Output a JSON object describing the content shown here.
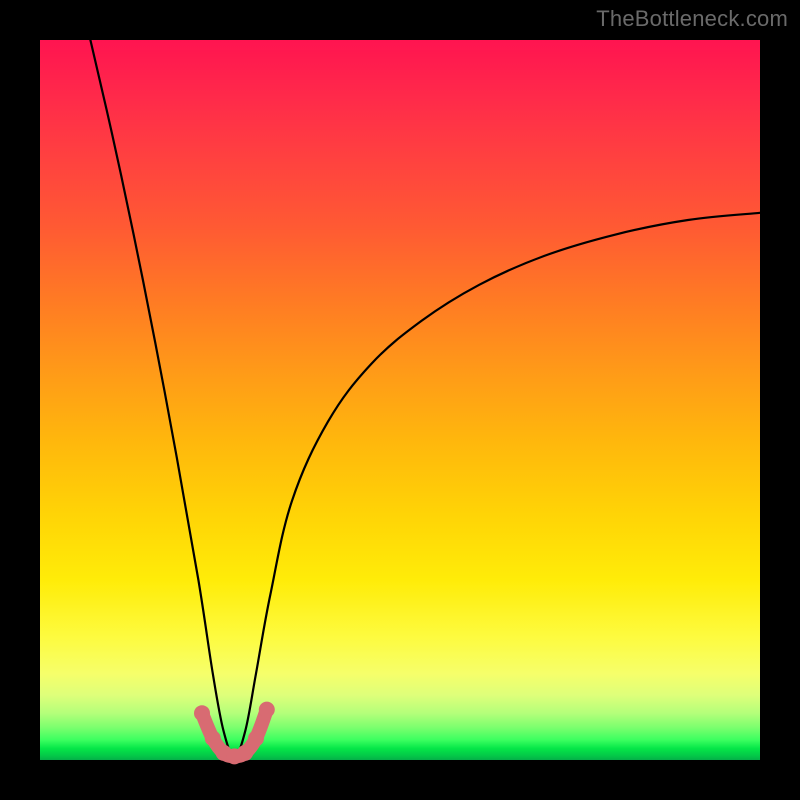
{
  "watermark": "TheBottleneck.com",
  "colors": {
    "frame": "#000000",
    "curve": "#000000",
    "accent": "#d86b72"
  },
  "chart_data": {
    "type": "line",
    "title": "",
    "xlabel": "",
    "ylabel": "",
    "xlim": [
      0,
      100
    ],
    "ylim": [
      0,
      100
    ],
    "grid": false,
    "legend": false,
    "description": "Bottleneck curve: a V-shaped curve plunging from near 100 on the left side down to ~0 at x≈27 and rising again to ~75 on the right edge, superimposed on a vertical red-to-green gradient where green (bottom) indicates the optimal balance point.",
    "series": [
      {
        "name": "bottleneck-curve",
        "x": [
          7,
          10,
          13,
          16,
          19,
          22,
          24,
          25.5,
          27,
          28.5,
          30,
          32,
          35,
          40,
          46,
          53,
          61,
          70,
          80,
          90,
          100
        ],
        "values": [
          100,
          87,
          73,
          58,
          42,
          25,
          12,
          4,
          0.5,
          4,
          12,
          23,
          36,
          47,
          55,
          61,
          66,
          70,
          73,
          75,
          76
        ]
      }
    ],
    "accent_region": {
      "name": "optimal-zone-marker",
      "x": [
        22.5,
        24,
        25.5,
        27,
        28.5,
        30,
        31.5
      ],
      "values": [
        6.5,
        3,
        1,
        0.5,
        1,
        3,
        7
      ]
    }
  }
}
